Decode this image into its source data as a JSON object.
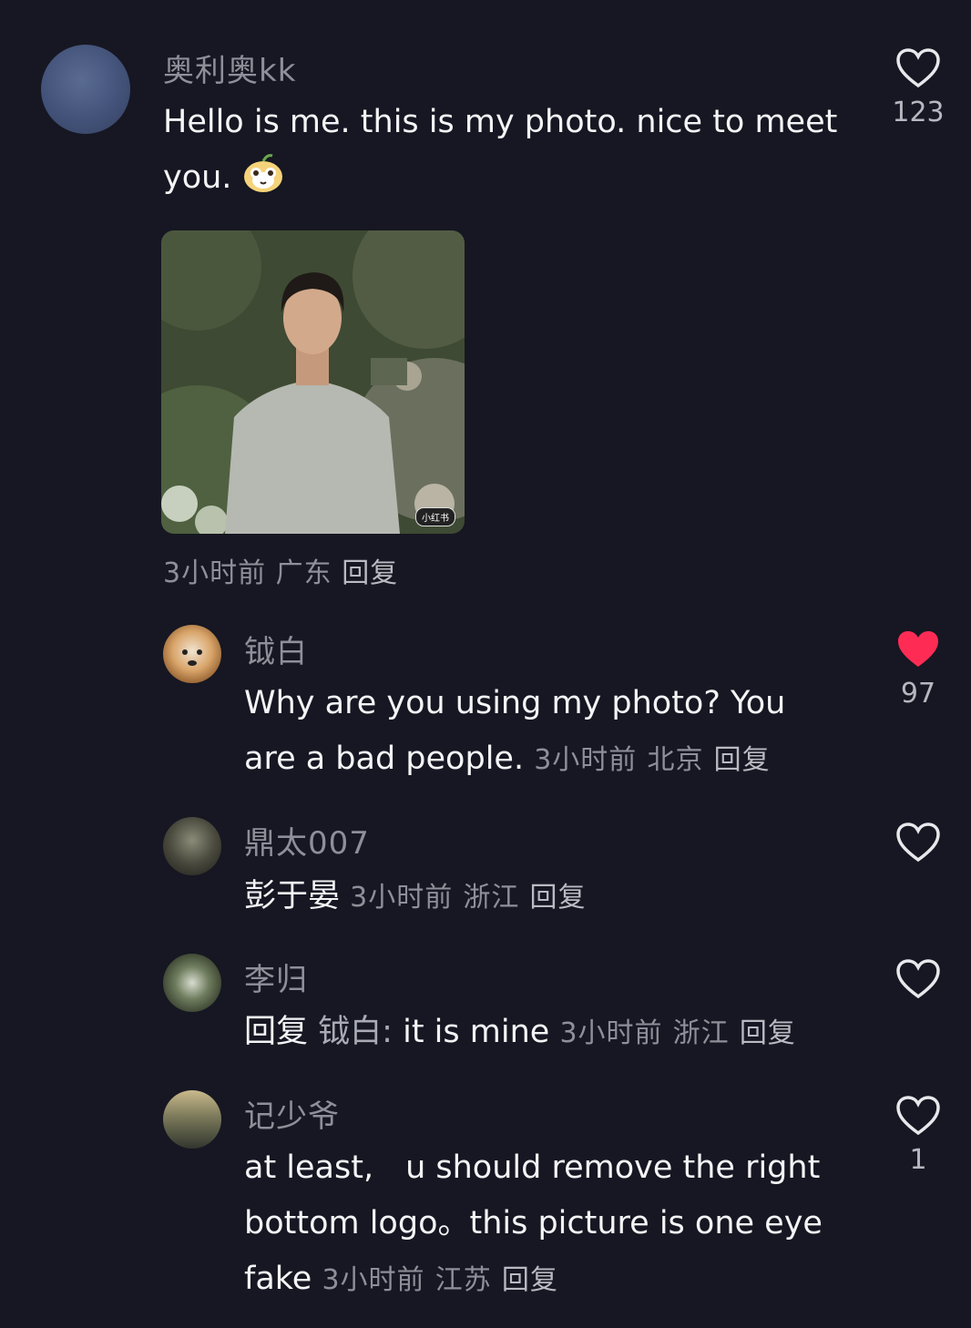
{
  "main_comment": {
    "username": "奥利奥kk",
    "text": "Hello is me. this is my photo. nice to meet you.",
    "meta_time": "3小时前",
    "meta_location": "广东",
    "reply_label": "回复",
    "like_count": "123",
    "liked": false
  },
  "replies": [
    {
      "username": "钺白",
      "text": "Why are you using my photo? You are a bad people.",
      "meta_time": "3小时前",
      "meta_location": "北京",
      "reply_label": "回复",
      "like_count": "97",
      "liked": true
    },
    {
      "username": "鼎太007",
      "text": "彭于晏",
      "meta_time": "3小时前",
      "meta_location": "浙江",
      "reply_label": "回复",
      "like_count": "",
      "liked": false
    },
    {
      "username": "李归",
      "reply_prefix": "回复",
      "reply_target": "钺白:",
      "text": "it is mine",
      "meta_time": "3小时前",
      "meta_location": "浙江",
      "reply_label": "回复",
      "like_count": "",
      "liked": false
    },
    {
      "username": "记少爷",
      "text_line1": "at least,　u should remove the right",
      "text_line2": "bottom logo。this picture is one eye",
      "text_line3": "fake",
      "meta_time": "3小时前",
      "meta_location": "江苏",
      "reply_label": "回复",
      "like_count": "1",
      "liked": false
    }
  ],
  "photo_watermark": "小红书",
  "colors": {
    "background": "#161722",
    "like_red": "#fe2c55",
    "meta_grey": "#8e8f98"
  }
}
